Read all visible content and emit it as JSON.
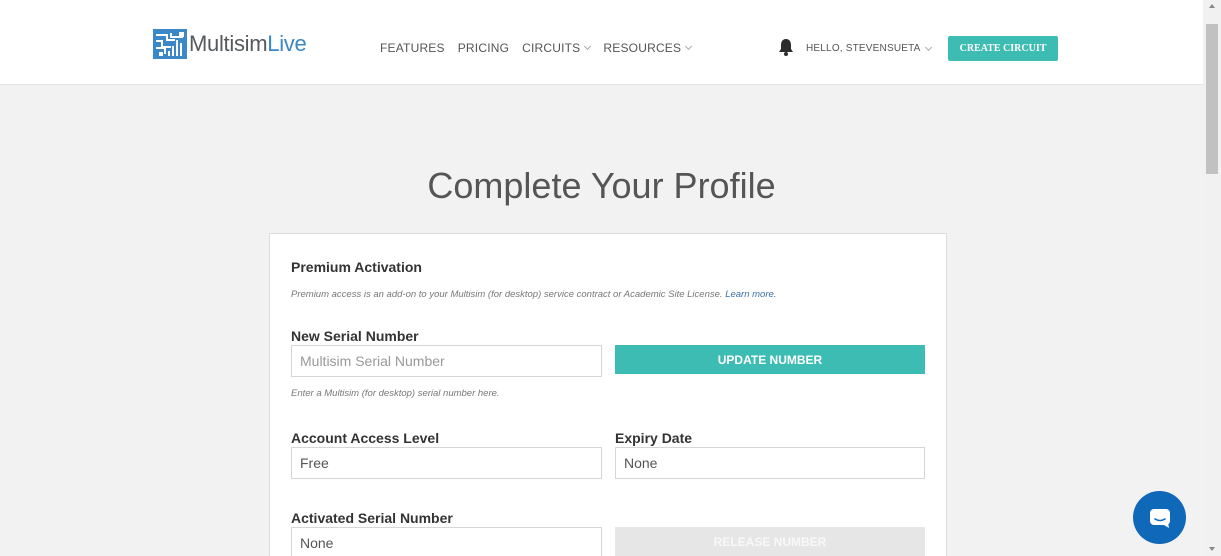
{
  "header": {
    "logo": {
      "part1": "Multisim",
      "part2": "Live"
    },
    "nav": [
      {
        "label": "FEATURES",
        "dropdown": false
      },
      {
        "label": "PRICING",
        "dropdown": false
      },
      {
        "label": "CIRCUITS",
        "dropdown": true
      },
      {
        "label": "RESOURCES",
        "dropdown": true
      }
    ],
    "greeting": "HELLO, STEVENSUETA",
    "create_button": "CREATE CIRCUIT"
  },
  "page": {
    "title": "Complete Your Profile"
  },
  "premium": {
    "title": "Premium Activation",
    "note": "Premium access is an add-on to your Multisim (for desktop) service contract or Academic Site License.",
    "learn_more": "Learn more."
  },
  "serial": {
    "label": "New Serial Number",
    "placeholder": "Multisim Serial Number",
    "button": "UPDATE NUMBER",
    "hint": "Enter a Multisim (for desktop) serial number here."
  },
  "access": {
    "label": "Account Access Level",
    "value": "Free"
  },
  "expiry": {
    "label": "Expiry Date",
    "value": "None"
  },
  "activated": {
    "label": "Activated Serial Number",
    "value": "None",
    "button": "RELEASE NUMBER"
  },
  "colors": {
    "accent": "#3cbcb3",
    "brand_blue": "#3a88c8",
    "chat": "#0f68b8"
  },
  "icons": {
    "logo": "multisim-logo-icon",
    "bell": "bell-icon",
    "chat": "chat-icon"
  }
}
